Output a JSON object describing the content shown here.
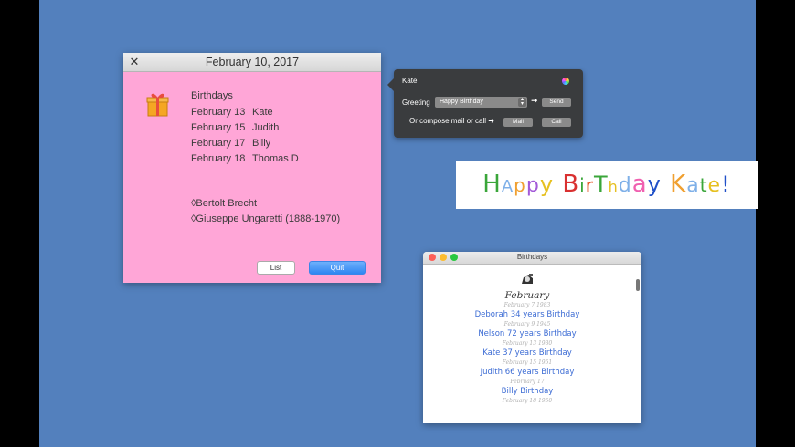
{
  "note": {
    "title": "February 10, 2017",
    "heading": "Birthdays",
    "birthdays": [
      {
        "date": "February 13",
        "name": "Kate"
      },
      {
        "date": "February 15",
        "name": "Judith"
      },
      {
        "date": "February 17",
        "name": "Billy"
      },
      {
        "date": "February 18",
        "name": "Thomas D"
      }
    ],
    "quotes": [
      "◊Bertolt Brecht",
      "◊Giuseppe Ungaretti (1888-1970)"
    ],
    "list_label": "List",
    "quit_label": "Quit"
  },
  "popover": {
    "name": "Kate",
    "greeting_label": "Greeting",
    "greeting_value": "Happy Birthday",
    "arrow": "➜",
    "send_label": "Send",
    "compose_label": "Or compose mail or call ➜",
    "mail_label": "Mail",
    "call_label": "Call"
  },
  "banner": {
    "letters": [
      {
        "ch": "H",
        "color": "#3aa63a"
      },
      {
        "ch": "A",
        "color": "#7fb0e8"
      },
      {
        "ch": "p",
        "color": "#f0a030"
      },
      {
        "ch": "p",
        "color": "#a35ad8"
      },
      {
        "ch": "y",
        "color": "#e6c020"
      },
      {
        "ch": " ",
        "color": "#000"
      },
      {
        "ch": "B",
        "color": "#d93030"
      },
      {
        "ch": "i",
        "color": "#3aa63a"
      },
      {
        "ch": "r",
        "color": "#e65020"
      },
      {
        "ch": "T",
        "color": "#3aa63a"
      },
      {
        "ch": "h",
        "color": "#e6c020"
      },
      {
        "ch": "d",
        "color": "#7fb0e8"
      },
      {
        "ch": "a",
        "color": "#f060b0"
      },
      {
        "ch": "y",
        "color": "#2050c8"
      },
      {
        "ch": " ",
        "color": "#000"
      },
      {
        "ch": "K",
        "color": "#f0a030"
      },
      {
        "ch": "a",
        "color": "#7fb0e8"
      },
      {
        "ch": "t",
        "color": "#3aa63a"
      },
      {
        "ch": "e",
        "color": "#e6c020"
      },
      {
        "ch": "!",
        "color": "#2050c8"
      }
    ]
  },
  "birthdays_window": {
    "title": "Birthdays",
    "month": "February",
    "entries": [
      {
        "sub": "February 7 1983",
        "main": "Deborah 34  years  Birthday"
      },
      {
        "sub": "February 9 1945",
        "main": "Nelson 72  years  Birthday"
      },
      {
        "sub": "February 13 1980",
        "main": "Kate 37  years  Birthday"
      },
      {
        "sub": "February 15 1951",
        "main": "Judith 66  years Birthday"
      },
      {
        "sub": "February 17",
        "main": "Billy  Birthday"
      }
    ],
    "trailing_sub": "February 18 1950"
  }
}
